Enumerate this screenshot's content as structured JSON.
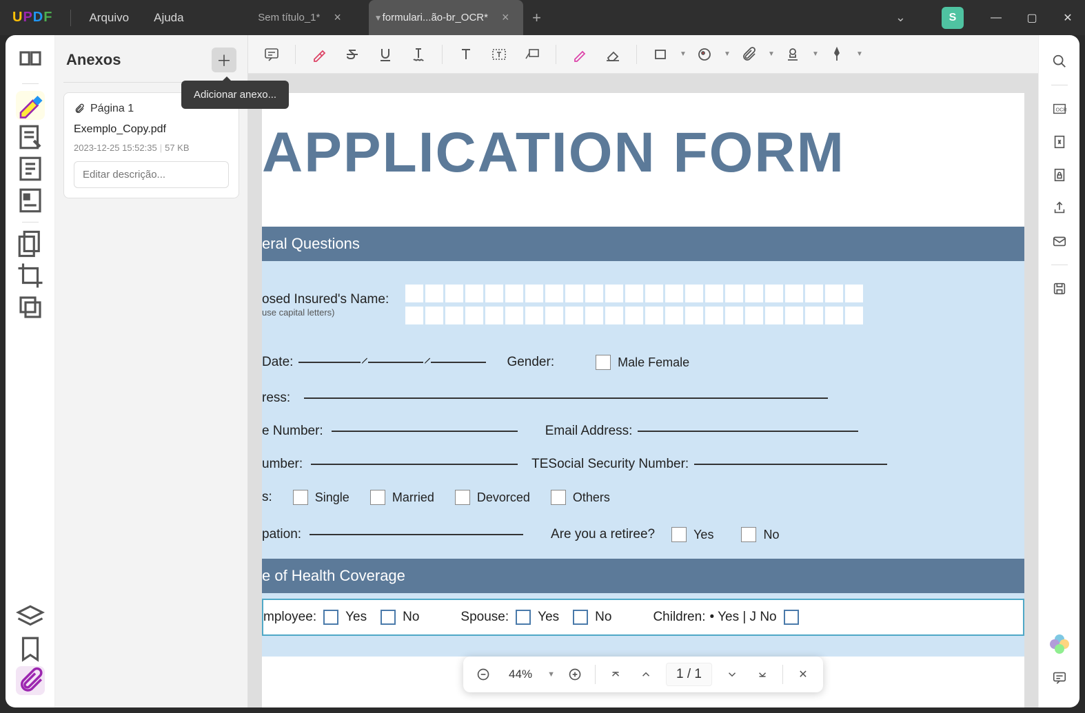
{
  "app": {
    "logo": "UPDF"
  },
  "menu": {
    "file": "Arquivo",
    "help": "Ajuda"
  },
  "tabs": {
    "inactive": "Sem título_1*",
    "active": "formulari...ão-br_OCR*"
  },
  "avatar": "S",
  "panel": {
    "title": "Anexos",
    "tooltip": "Adicionar anexo...",
    "page_label": "Página 1",
    "filename": "Exemplo_Copy.pdf",
    "timestamp": "2023-12-25 15:52:35",
    "filesize": "57 KB",
    "desc_placeholder": "Editar descrição..."
  },
  "doc": {
    "title": "APPLICATION FORM",
    "section1": "eral Questions",
    "name_label": "osed Insured's Name:",
    "name_note": "use capital letters)",
    "date_label": "Date:",
    "gender_label": "Gender:",
    "gender_opts": "Male Female",
    "address_label": "ress:",
    "phone_label": "e Number:",
    "email_label": "Email Address:",
    "number_label": "umber:",
    "ssn_label": "TESocial Security Number:",
    "status_label": "s:",
    "status_single": "Single",
    "status_married": "Married",
    "status_divorced": "Devorced",
    "status_others": "Others",
    "occupation_label": "pation:",
    "retiree_q": "Are you a retiree?",
    "yes": "Yes",
    "no": "No",
    "section2": "e of Health Coverage",
    "employee_label": "mployee:",
    "spouse_label": "Spouse:",
    "children_label": "Children:",
    "children_val": "• Yes | J No"
  },
  "nav": {
    "zoom": "44%",
    "page": "1 / 1"
  }
}
